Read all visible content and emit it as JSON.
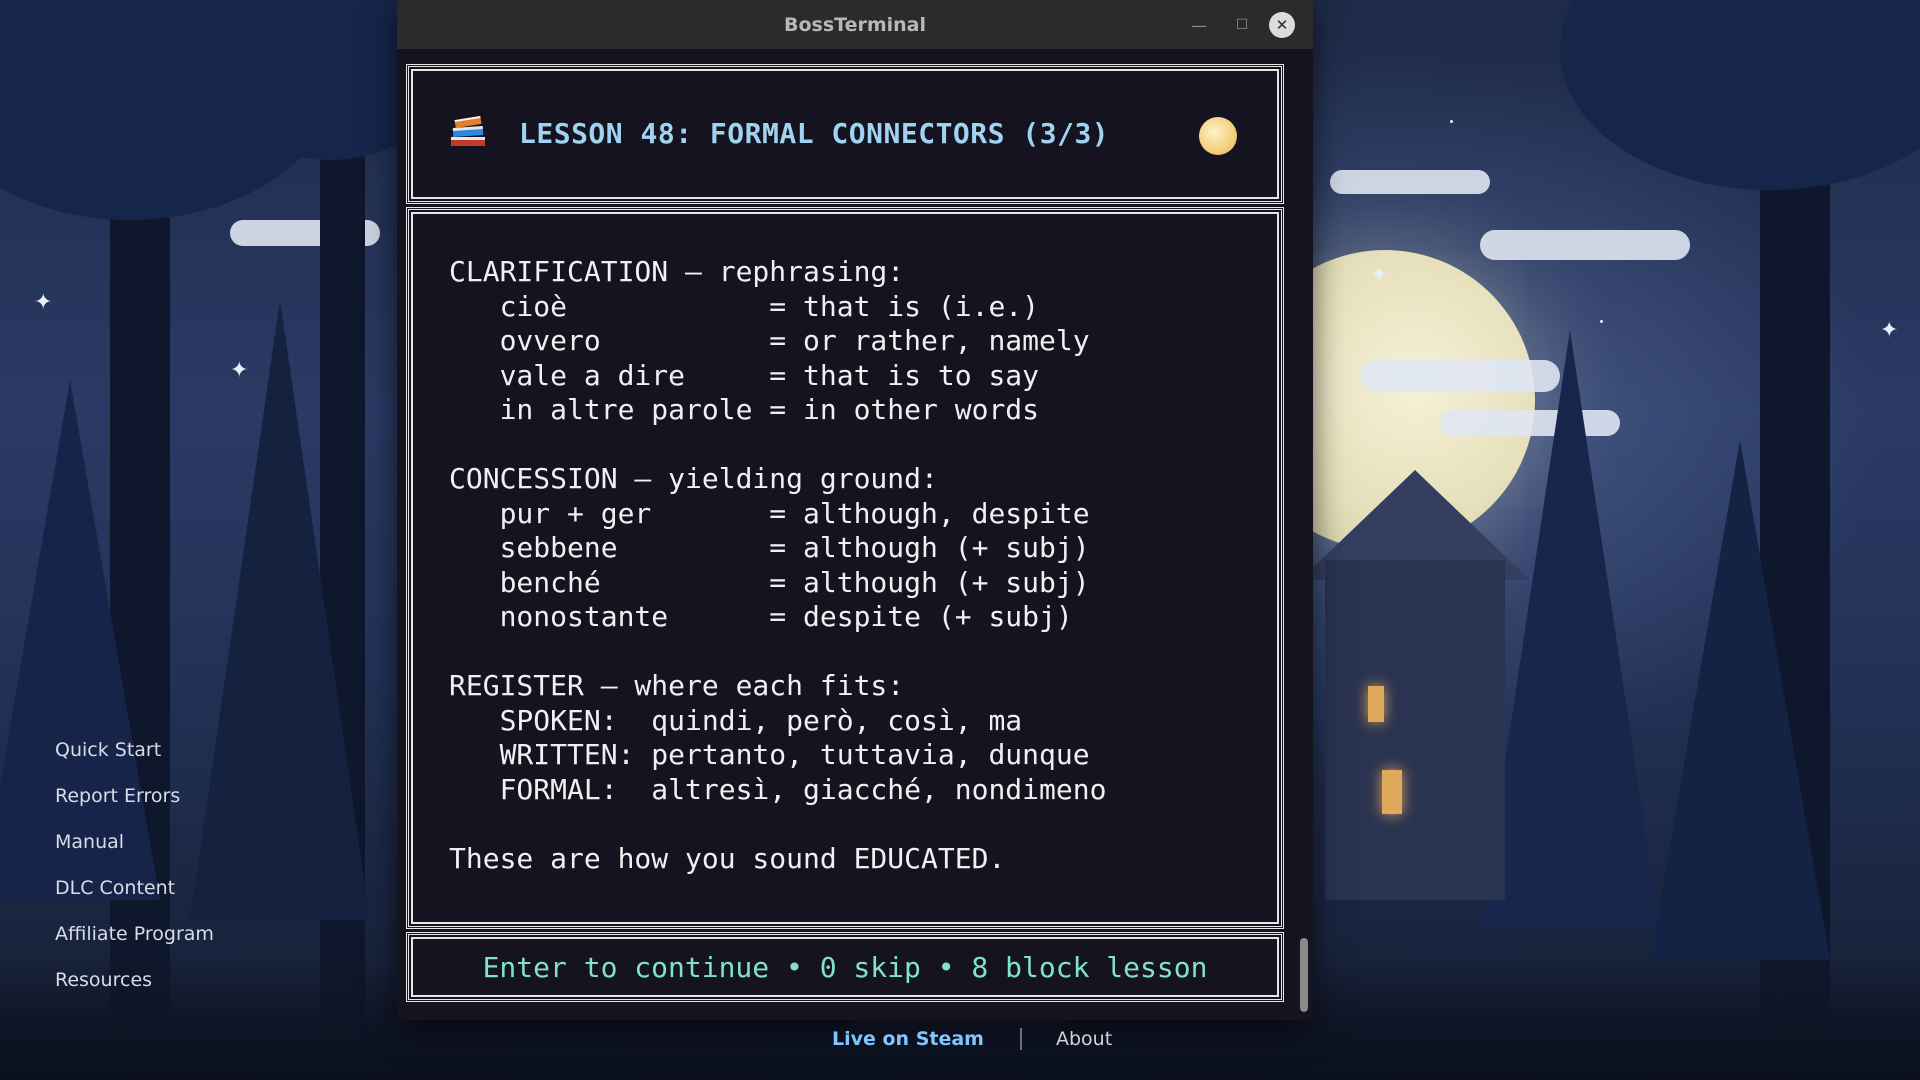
{
  "window": {
    "title": "BossTerminal",
    "minimize_glyph": "—",
    "maximize_glyph": "☐",
    "close_glyph": "✕"
  },
  "lesson": {
    "icon": "books-icon",
    "title": "LESSON 48: FORMAL CONNECTORS (3/3)",
    "status_icon": "moon-icon",
    "body": "CLARIFICATION — rephrasing:\n   cioè            = that is (i.e.)\n   ovvero          = or rather, namely\n   vale a dire     = that is to say\n   in altre parole = in other words\n\nCONCESSION — yielding ground:\n   pur + ger       = although, despite\n   sebbene         = although (+ subj)\n   benché          = although (+ subj)\n   nonostante      = despite (+ subj)\n\nREGISTER — where each fits:\n   SPOKEN:  quindi, però, così, ma\n   WRITTEN: pertanto, tuttavia, dunque\n   FORMAL:  altresì, giacché, nondimeno\n\nThese are how you sound EDUCATED.",
    "footer_hint": "Enter to continue • 0 skip • 8 block lesson"
  },
  "side_nav": {
    "items": [
      "Quick Start",
      "Report Errors",
      "Manual",
      "DLC Content",
      "Affiliate Program",
      "Resources"
    ]
  },
  "bottom_links": {
    "steam": "Live on Steam",
    "about": "About"
  },
  "colors": {
    "title_accent": "#9fd3f0",
    "footer_accent": "#7fe3c4",
    "steam_link": "#7fc6ff",
    "terminal_bg": "#151320"
  }
}
